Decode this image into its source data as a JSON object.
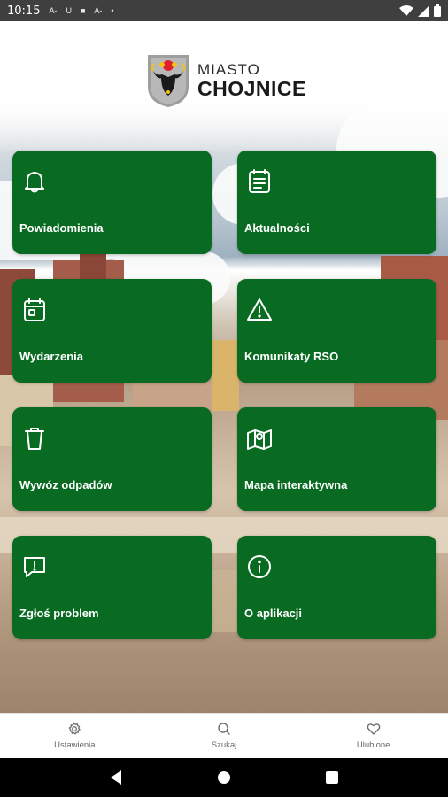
{
  "status_bar": {
    "time": "10:15",
    "mini_icons": [
      "a-icon",
      "u-icon",
      "square-icon",
      "a-icon",
      "dot-icon"
    ]
  },
  "header": {
    "line1": "MIASTO",
    "line2": "CHOJNICE"
  },
  "tiles": [
    {
      "label": "Powiadomienia",
      "icon": "bell-icon"
    },
    {
      "label": "Aktualności",
      "icon": "news-icon"
    },
    {
      "label": "Wydarzenia",
      "icon": "calendar-icon"
    },
    {
      "label": "Komunikaty RSO",
      "icon": "warning-icon"
    },
    {
      "label": "Wywóz odpadów",
      "icon": "trash-icon"
    },
    {
      "label": "Mapa interaktywna",
      "icon": "map-icon"
    },
    {
      "label": "Zgłoś problem",
      "icon": "report-icon"
    },
    {
      "label": "O aplikacji",
      "icon": "info-icon"
    }
  ],
  "bottom_nav": [
    {
      "label": "Ustawienia",
      "icon": "gear-icon"
    },
    {
      "label": "Szukaj",
      "icon": "search-icon"
    },
    {
      "label": "Ulubione",
      "icon": "heart-icon"
    }
  ],
  "colors": {
    "tile": "#086b21",
    "status_bar": "#3f3f3f"
  }
}
